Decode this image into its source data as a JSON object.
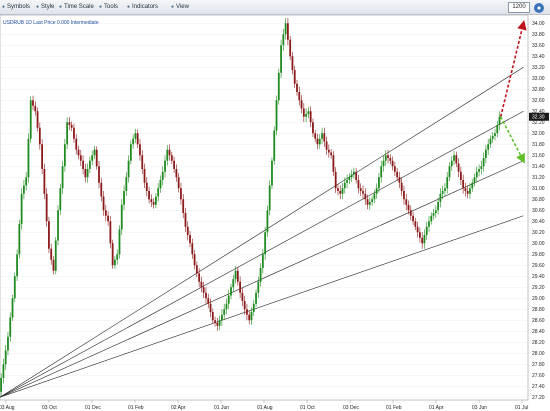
{
  "toolbar": {
    "items": [
      {
        "label": "Symbols",
        "icon": "star-icon"
      },
      {
        "label": "Style",
        "icon": "style-icon"
      },
      {
        "label": "Time Scale",
        "icon": "clock-icon"
      },
      {
        "label": "Tools",
        "icon": "tools-icon"
      },
      {
        "label": "Indicators",
        "icon": "indicators-icon"
      },
      {
        "label": "View",
        "icon": "view-icon"
      }
    ],
    "count_value": "1200",
    "settings_icon": "settings-icon"
  },
  "chart": {
    "legend": "USDRUB 1D Last Price 0.000 Intermediate",
    "last_price_label": "32.30",
    "colors": {
      "up": "#1f8a1f",
      "down": "#8b1a1a",
      "trend": "#222222",
      "arrow_up": "#c0141c",
      "arrow_down": "#5fbf2a",
      "grid": "#e8e8e8",
      "axis": "#999999",
      "price_tag_bg": "#1a1a1a"
    }
  },
  "chart_data": {
    "type": "candlestick",
    "x_ticks": [
      "03 Aug",
      "03 Oct",
      "01 Dec",
      "01 Feb",
      "02 Apr",
      "01 Jun",
      "01 Aug",
      "01 Oct",
      "03 Dec",
      "01 Feb",
      "01 Apr",
      "03 Jun",
      "01 Jul"
    ],
    "y_ticks": [
      "34.00",
      "33.80",
      "33.60",
      "33.40",
      "33.20",
      "33.00",
      "32.80",
      "32.60",
      "32.40",
      "32.20",
      "32.00",
      "31.80",
      "31.60",
      "31.40",
      "31.20",
      "31.00",
      "30.80",
      "30.60",
      "30.40",
      "30.20",
      "30.00",
      "29.80",
      "29.60",
      "29.40",
      "29.20",
      "29.00",
      "28.80",
      "28.60",
      "28.40",
      "28.20",
      "28.00",
      "27.80",
      "27.60",
      "27.40",
      "27.20"
    ],
    "ylim": [
      27.15,
      34.15
    ],
    "price_path": [
      [
        0,
        27.3
      ],
      [
        2,
        27.8
      ],
      [
        4,
        28.3
      ],
      [
        6,
        29.0
      ],
      [
        8,
        29.8
      ],
      [
        10,
        30.9
      ],
      [
        12,
        31.2
      ],
      [
        14,
        32.6
      ],
      [
        16,
        32.4
      ],
      [
        18,
        31.8
      ],
      [
        20,
        30.9
      ],
      [
        22,
        29.9
      ],
      [
        24,
        29.5
      ],
      [
        26,
        30.6
      ],
      [
        28,
        31.4
      ],
      [
        30,
        32.2
      ],
      [
        32,
        32.1
      ],
      [
        34,
        31.7
      ],
      [
        36,
        31.5
      ],
      [
        38,
        31.2
      ],
      [
        40,
        31.5
      ],
      [
        42,
        31.7
      ],
      [
        44,
        31.1
      ],
      [
        46,
        30.6
      ],
      [
        48,
        30.4
      ],
      [
        50,
        29.6
      ],
      [
        52,
        29.8
      ],
      [
        54,
        30.7
      ],
      [
        56,
        31.2
      ],
      [
        58,
        31.8
      ],
      [
        60,
        32.0
      ],
      [
        62,
        31.6
      ],
      [
        64,
        31.1
      ],
      [
        66,
        30.8
      ],
      [
        68,
        30.7
      ],
      [
        70,
        31.0
      ],
      [
        72,
        31.3
      ],
      [
        74,
        31.7
      ],
      [
        76,
        31.5
      ],
      [
        78,
        31.2
      ],
      [
        80,
        30.8
      ],
      [
        82,
        30.3
      ],
      [
        84,
        30.0
      ],
      [
        86,
        29.6
      ],
      [
        88,
        29.3
      ],
      [
        90,
        29.1
      ],
      [
        92,
        28.9
      ],
      [
        94,
        28.6
      ],
      [
        96,
        28.5
      ],
      [
        98,
        28.7
      ],
      [
        100,
        28.9
      ],
      [
        102,
        29.2
      ],
      [
        104,
        29.5
      ],
      [
        106,
        29.1
      ],
      [
        108,
        28.8
      ],
      [
        110,
        28.6
      ],
      [
        112,
        28.9
      ],
      [
        114,
        29.3
      ],
      [
        116,
        29.8
      ],
      [
        118,
        30.6
      ],
      [
        120,
        31.5
      ],
      [
        122,
        32.6
      ],
      [
        124,
        33.6
      ],
      [
        126,
        34.0
      ],
      [
        128,
        33.4
      ],
      [
        130,
        32.9
      ],
      [
        132,
        32.6
      ],
      [
        134,
        32.3
      ],
      [
        136,
        32.4
      ],
      [
        138,
        32.0
      ],
      [
        140,
        31.8
      ],
      [
        142,
        32.0
      ],
      [
        144,
        31.7
      ],
      [
        146,
        31.6
      ],
      [
        148,
        31.0
      ],
      [
        150,
        30.9
      ],
      [
        152,
        31.1
      ],
      [
        154,
        31.2
      ],
      [
        156,
        31.3
      ],
      [
        158,
        31.0
      ],
      [
        160,
        30.9
      ],
      [
        162,
        30.7
      ],
      [
        164,
        30.8
      ],
      [
        166,
        31.0
      ],
      [
        168,
        31.4
      ],
      [
        170,
        31.6
      ],
      [
        172,
        31.5
      ],
      [
        174,
        31.3
      ],
      [
        176,
        31.1
      ],
      [
        178,
        30.8
      ],
      [
        180,
        30.6
      ],
      [
        182,
        30.4
      ],
      [
        184,
        30.2
      ],
      [
        186,
        30.0
      ],
      [
        188,
        30.3
      ],
      [
        190,
        30.5
      ],
      [
        192,
        30.6
      ],
      [
        194,
        30.9
      ],
      [
        196,
        31.0
      ],
      [
        198,
        31.4
      ],
      [
        200,
        31.6
      ],
      [
        202,
        31.3
      ],
      [
        204,
        31.0
      ],
      [
        206,
        30.9
      ],
      [
        208,
        31.1
      ],
      [
        210,
        31.3
      ],
      [
        212,
        31.4
      ],
      [
        214,
        31.7
      ],
      [
        216,
        31.9
      ],
      [
        218,
        32.0
      ],
      [
        220,
        32.3
      ]
    ],
    "trend_lines": [
      {
        "from": [
          0,
          27.2
        ],
        "to": [
          230,
          32.4
        ]
      },
      {
        "from": [
          0,
          27.2
        ],
        "to": [
          230,
          31.5
        ]
      },
      {
        "from": [
          0,
          27.2
        ],
        "to": [
          230,
          30.5
        ]
      },
      {
        "from": [
          0,
          27.2
        ],
        "to": [
          230,
          33.2
        ]
      }
    ],
    "arrows": [
      {
        "from": [
          220,
          32.3
        ],
        "to": [
          230,
          34.0
        ],
        "color": "up"
      },
      {
        "from": [
          220,
          32.3
        ],
        "to": [
          230,
          31.5
        ],
        "color": "down"
      }
    ]
  }
}
